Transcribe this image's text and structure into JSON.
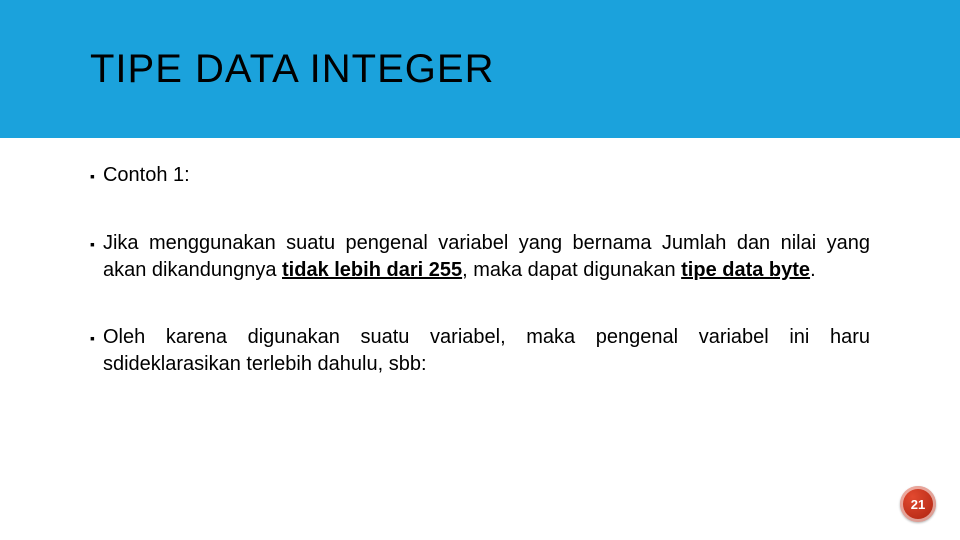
{
  "header": {
    "title": "TIPE DATA INTEGER"
  },
  "bullets": [
    {
      "segments": [
        {
          "text": "Contoh 1:",
          "style": ""
        }
      ]
    },
    {
      "segments": [
        {
          "text": "Jika menggunakan suatu pengenal variabel yang bernama Jumlah dan nilai yang akan dikandungnya ",
          "style": ""
        },
        {
          "text": "tidak lebih dari 255",
          "style": "ul-bold"
        },
        {
          "text": ", maka dapat digunakan ",
          "style": ""
        },
        {
          "text": "tipe data byte",
          "style": "ul-bold"
        },
        {
          "text": ".",
          "style": ""
        }
      ]
    },
    {
      "segments": [
        {
          "text": "Oleh karena digunakan suatu variabel, maka pengenal variabel ini haru sdideklarasikan terlebih dahulu, sbb:",
          "style": ""
        }
      ]
    }
  ],
  "page_number": "21"
}
